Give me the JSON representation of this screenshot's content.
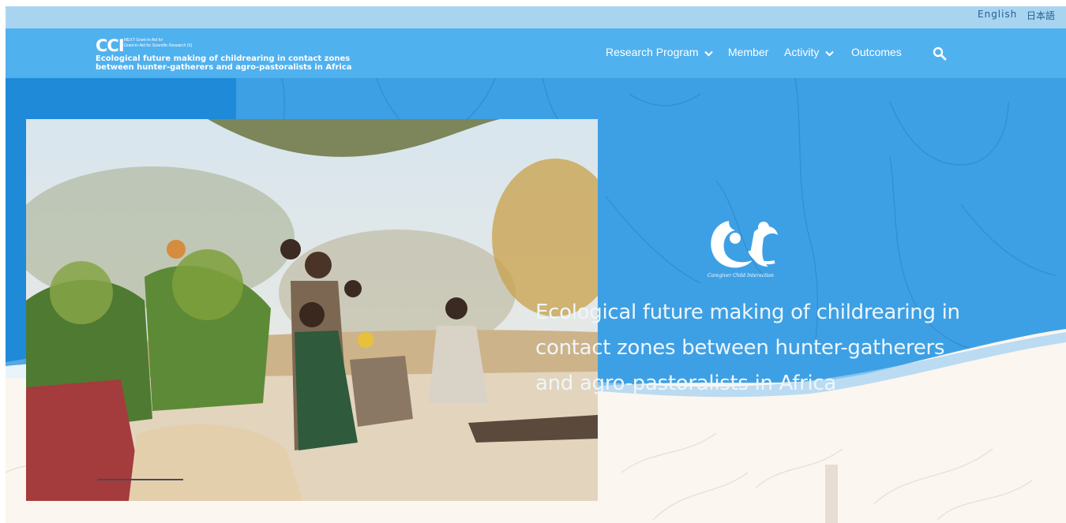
{
  "lang": {
    "english": "English",
    "japanese": "日本語"
  },
  "logo": {
    "acronym": "CCI",
    "grant_line1": "MEXT Grant-in-Aid for",
    "grant_line2": "Grant-in-Aid for Scientific Research (S)",
    "title": "Ecological future making of childrearing in contact zones between hunter-gatherers and agro-pastoralists in Africa"
  },
  "nav": {
    "research_program": "Research Program",
    "member": "Member",
    "activity": "Activity",
    "outcomes": "Outcomes"
  },
  "hero": {
    "emblem_caption": "Caregiver Child Interaction",
    "tagline": "Ecological future making of childrearing in contact zones between hunter-gatherers and agro-pastoralists in Africa",
    "photo_subject": "children-photo",
    "slide_progress": 0.25
  },
  "icons": {
    "search": "search-icon",
    "dropdown": "chevron-down-icon"
  },
  "colors": {
    "header": "#50b1ef",
    "lang_bar": "#a9d4f0",
    "hero": "#2a93dd",
    "cream": "#fbf6ef"
  }
}
